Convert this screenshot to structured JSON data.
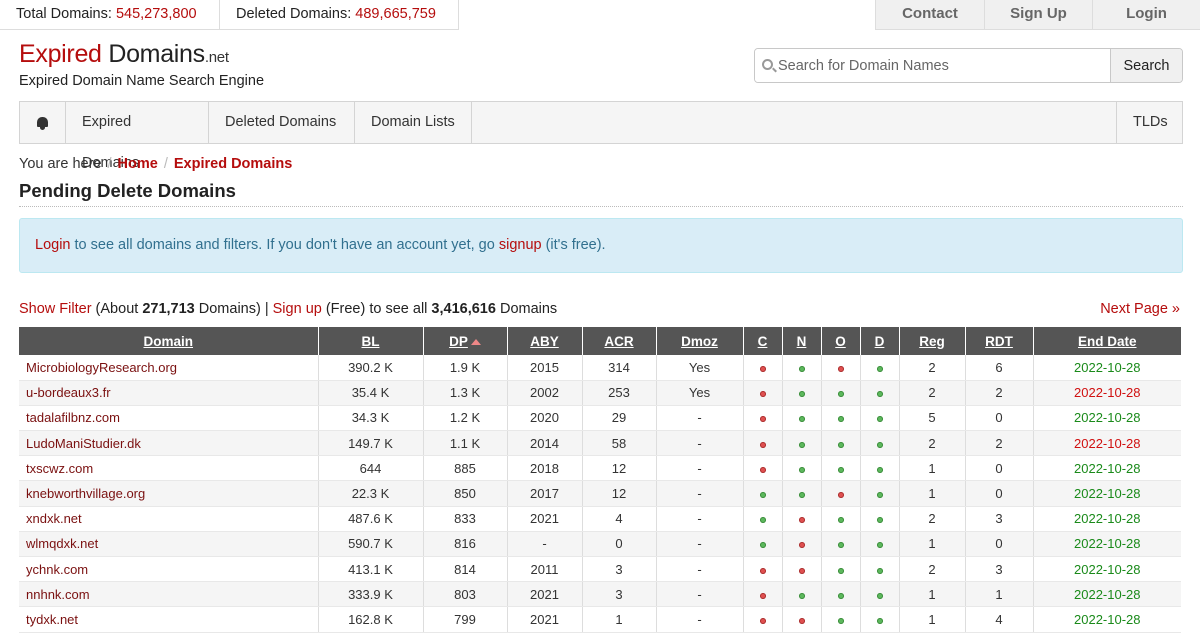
{
  "stats": {
    "total_label": "Total Domains:",
    "total_value": "545,273,800",
    "deleted_label": "Deleted Domains:",
    "deleted_value": "489,665,759"
  },
  "top_links": [
    "Contact",
    "Sign Up",
    "Login"
  ],
  "logo": {
    "part1": "Expired",
    "part2": " Domains",
    "tld": ".net",
    "subtitle": "Expired Domain Name Search Engine"
  },
  "search": {
    "placeholder": "Search for Domain Names",
    "button": "Search"
  },
  "nav": {
    "home_icon": "bell-icon",
    "items": [
      "Expired Domains",
      "Deleted Domains",
      "Domain Lists"
    ],
    "tlds": "TLDs"
  },
  "breadcrumb": {
    "prefix": "You are here",
    "home": "Home",
    "current": "Expired Domains"
  },
  "page_title": "Pending Delete Domains",
  "alert": {
    "login": "Login",
    "text1": " to see all domains and filters. If you don't have an account yet, go ",
    "signup": "signup",
    "text2": " (it's free)."
  },
  "filter": {
    "show_filter": "Show Filter",
    "about_prefix": " (About ",
    "about_count": "271,713",
    "about_suffix": " Domains) | ",
    "signup": "Sign up",
    "free_text": " (Free) to see all ",
    "total_count": "3,416,616",
    "domains_word": " Domains",
    "next_page": "Next Page »"
  },
  "table": {
    "columns": [
      "Domain",
      "BL",
      "DP",
      "ABY",
      "ACR",
      "Dmoz",
      "C",
      "N",
      "O",
      "D",
      "Reg",
      "RDT",
      "End Date"
    ],
    "rows": [
      {
        "domain": "MicrobiologyResearch.org",
        "bl": "390.2 K",
        "dp": "1.9 K",
        "aby": "2015",
        "acr": "314",
        "dmoz": "Yes",
        "c": "red",
        "n": "green",
        "o": "red",
        "d": "green",
        "reg": "2",
        "rdt": "6",
        "end": "2022-10-28",
        "end_color": "green"
      },
      {
        "domain": "u-bordeaux3.fr",
        "bl": "35.4 K",
        "dp": "1.3 K",
        "aby": "2002",
        "acr": "253",
        "dmoz": "Yes",
        "c": "red",
        "n": "green",
        "o": "green",
        "d": "green",
        "reg": "2",
        "rdt": "2",
        "end": "2022-10-28",
        "end_color": "red"
      },
      {
        "domain": "tadalafilbnz.com",
        "bl": "34.3 K",
        "dp": "1.2 K",
        "aby": "2020",
        "acr": "29",
        "dmoz": "-",
        "c": "red",
        "n": "green",
        "o": "green",
        "d": "green",
        "reg": "5",
        "rdt": "0",
        "end": "2022-10-28",
        "end_color": "green"
      },
      {
        "domain": "LudoManiStudier.dk",
        "bl": "149.7 K",
        "dp": "1.1 K",
        "aby": "2014",
        "acr": "58",
        "dmoz": "-",
        "c": "red",
        "n": "green",
        "o": "green",
        "d": "green",
        "reg": "2",
        "rdt": "2",
        "end": "2022-10-28",
        "end_color": "red"
      },
      {
        "domain": "txscwz.com",
        "bl": "644",
        "dp": "885",
        "aby": "2018",
        "acr": "12",
        "dmoz": "-",
        "c": "red",
        "n": "green",
        "o": "green",
        "d": "green",
        "reg": "1",
        "rdt": "0",
        "end": "2022-10-28",
        "end_color": "green"
      },
      {
        "domain": "knebworthvillage.org",
        "bl": "22.3 K",
        "dp": "850",
        "aby": "2017",
        "acr": "12",
        "dmoz": "-",
        "c": "green",
        "n": "green",
        "o": "red",
        "d": "green",
        "reg": "1",
        "rdt": "0",
        "end": "2022-10-28",
        "end_color": "green"
      },
      {
        "domain": "xndxk.net",
        "bl": "487.6 K",
        "dp": "833",
        "aby": "2021",
        "acr": "4",
        "dmoz": "-",
        "c": "green",
        "n": "red",
        "o": "green",
        "d": "green",
        "reg": "2",
        "rdt": "3",
        "end": "2022-10-28",
        "end_color": "green"
      },
      {
        "domain": "wlmqdxk.net",
        "bl": "590.7 K",
        "dp": "816",
        "aby": "-",
        "acr": "0",
        "dmoz": "-",
        "c": "green",
        "n": "red",
        "o": "green",
        "d": "green",
        "reg": "1",
        "rdt": "0",
        "end": "2022-10-28",
        "end_color": "green"
      },
      {
        "domain": "ychnk.com",
        "bl": "413.1 K",
        "dp": "814",
        "aby": "2011",
        "acr": "3",
        "dmoz": "-",
        "c": "red",
        "n": "red",
        "o": "green",
        "d": "green",
        "reg": "2",
        "rdt": "3",
        "end": "2022-10-28",
        "end_color": "green"
      },
      {
        "domain": "nnhnk.com",
        "bl": "333.9 K",
        "dp": "803",
        "aby": "2021",
        "acr": "3",
        "dmoz": "-",
        "c": "red",
        "n": "green",
        "o": "green",
        "d": "green",
        "reg": "1",
        "rdt": "1",
        "end": "2022-10-28",
        "end_color": "green"
      },
      {
        "domain": "tydxk.net",
        "bl": "162.8 K",
        "dp": "799",
        "aby": "2021",
        "acr": "1",
        "dmoz": "-",
        "c": "red",
        "n": "red",
        "o": "green",
        "d": "green",
        "reg": "1",
        "rdt": "4",
        "end": "2022-10-28",
        "end_color": "green"
      }
    ]
  }
}
